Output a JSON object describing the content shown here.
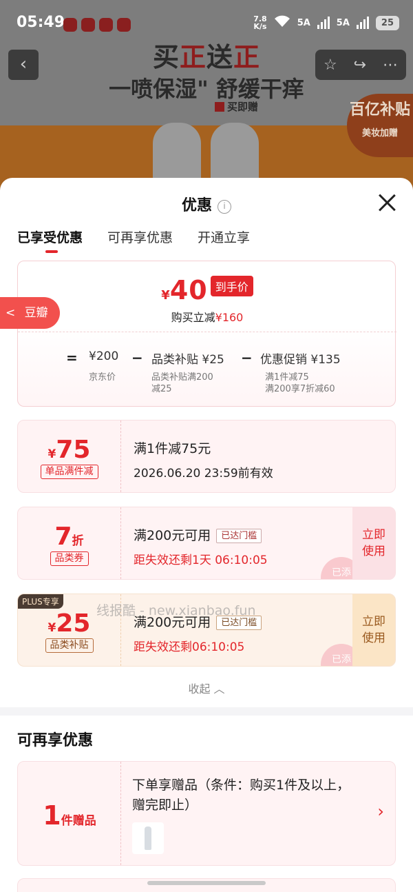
{
  "status_bar": {
    "time": "05:49",
    "net_speed_top": "7.8",
    "net_speed_unit": "K/s",
    "signal1": "5A",
    "signal2": "5A",
    "battery": "25"
  },
  "background": {
    "headline_part1": "买",
    "headline_red1": "正",
    "headline_part2": "送",
    "headline_red2": "正",
    "headline2": "一喷保湿\" 舒缓干痒",
    "gift_label": "买即赠",
    "badge_line1": "百亿补贴",
    "badge_line2": "美妆加赠"
  },
  "sheet": {
    "title": "优惠",
    "info_icon": "i",
    "tabs": [
      {
        "label": "已享受优惠",
        "active": true
      },
      {
        "label": "可再享优惠",
        "active": false
      },
      {
        "label": "开通立享",
        "active": false
      }
    ]
  },
  "side_tab": {
    "label": "豆瓣",
    "arrow": "<"
  },
  "summary": {
    "currency": "¥",
    "final_price": "40",
    "final_tag": "到手价",
    "sub_prefix": "购买立减",
    "sub_amount": "¥160",
    "eq": "=",
    "minus": "−",
    "base_amount": "¥200",
    "base_label": "京东价",
    "item2_title": "品类补贴",
    "item2_amount": "¥25",
    "item2_note_l1": "品类补贴满200",
    "item2_note_l2": "减25",
    "item3_title": "优惠促销",
    "item3_amount": "¥135",
    "item3_note_l1": "满1件减75",
    "item3_note_l2": "满200享7折减60"
  },
  "coupons": [
    {
      "currency": "¥",
      "amount": "75",
      "label": "单品满件减",
      "title": "满1件减75元",
      "subtitle": "2026.06.20 23:59前有效"
    },
    {
      "amount": "7",
      "unit": "折",
      "label": "品类券",
      "title": "满200元可用",
      "reach_tag": "已达门槛",
      "subtitle": "距失效还剩1天 06:10:05",
      "button": "立即使用",
      "stamp": "已添"
    },
    {
      "plus_tag": "PLUS专享",
      "currency": "¥",
      "amount": "25",
      "label": "品类补贴",
      "title": "满200元可用",
      "reach_tag": "已达门槛",
      "subtitle": "距失效还剩06:10:05",
      "button": "立即使用",
      "stamp": "已添"
    }
  ],
  "collapse_label": "收起 ︿",
  "more_section": {
    "title": "可再享优惠",
    "gift": {
      "count": "1",
      "unit": "件赠品",
      "title": "下单享赠品（条件：购买1件及以上，赠完即止）",
      "arrow": "›"
    },
    "watermark": "线报酷 - new.xianbao.fun"
  },
  "colors": {
    "accent_red": "#e3262b",
    "plus_gold": "#fbe5c6"
  }
}
